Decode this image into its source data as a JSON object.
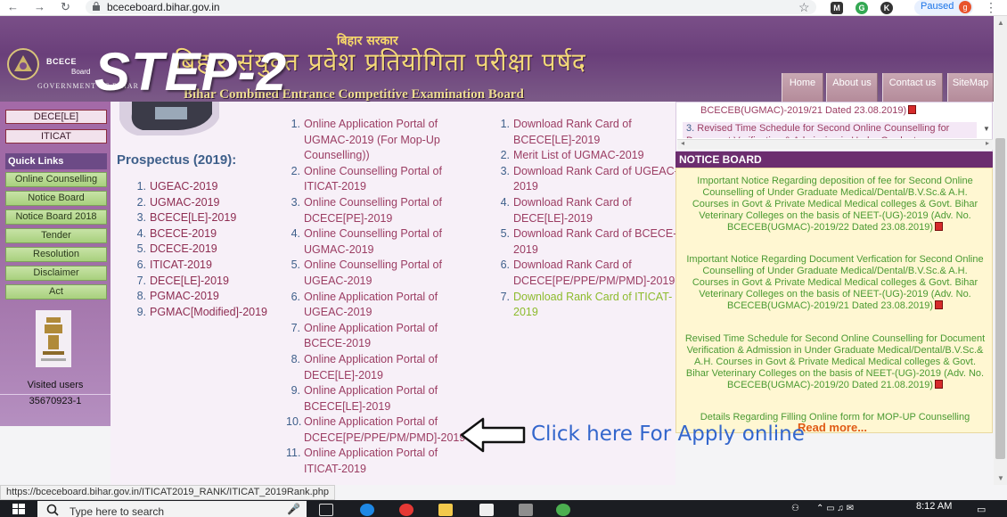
{
  "browser": {
    "url": "bceceboard.bihar.gov.in",
    "profile_status": "Paused",
    "profile_initial": "g",
    "extension_k": "K"
  },
  "header": {
    "logo_text": "BCECE",
    "logo_sub": "Board",
    "gov_text": "GOVERNMENT OF BIHAR",
    "hindi_state": "बिहार सरकार",
    "hindi_title": "बिहार संयुक्त प्रवेश प्रतियोगिता परीक्षा पर्षद",
    "english_title": "Bihar Combined Entrance Competitive Examination Board",
    "step_overlay": "STEP-2",
    "nav": [
      "Home",
      "About us",
      "Contact us",
      "SiteMap"
    ]
  },
  "sidebar": {
    "top_items": [
      "DECE[LE]",
      "ITICAT"
    ],
    "quick_links_title": "Quick Links",
    "quick_links": [
      "Online Counselling",
      "Notice Board",
      "Notice Board 2018",
      "Tender",
      "Resolution",
      "Disclaimer",
      "Act"
    ],
    "visited_label": "Visited users",
    "visited_count": "35670923-1"
  },
  "prospectus": {
    "title": "Prospectus (2019):",
    "items": [
      "UGEAC-2019",
      "UGMAC-2019",
      "BCECE[LE]-2019",
      "BCECE-2019",
      "DCECE-2019",
      "ITICAT-2019",
      "DECE[LE]-2019",
      "PGMAC-2019",
      "PGMAC[Modified]-2019"
    ]
  },
  "portals": {
    "items": [
      "Online Application Portal of UGMAC-2019 (For Mop-Up Counselling))",
      "Online Counselling Portal of ITICAT-2019",
      "Online Counselling Portal of DCECE[PE]-2019",
      "Online Counselling Portal of UGMAC-2019",
      "Online Counselling Portal of UGEAC-2019",
      "Online Application Portal of UGEAC-2019",
      "Online Application Portal of BCECE-2019",
      "Online Application Portal of DECE[LE]-2019",
      "Online Application Portal of BCECE[LE]-2019",
      "Online Application Portal of DCECE[PE/PPE/PM/PMD]-2019",
      "Online Application Portal of ITICAT-2019"
    ]
  },
  "results": {
    "items": [
      "Download Rank Card of BCECE[LE]-2019",
      "Merit List of UGMAC-2019",
      "Download Rank Card of UGEAC-2019",
      "Download Rank Card of DECE[LE]-2019",
      "Download Rank Card of BCECE-2019",
      "Download Rank Card of DCECE[PE/PPE/PM/PMD]-2019",
      "Download Rank Card of ITICAT-2019"
    ]
  },
  "scroll_box": {
    "top_text": "BCECEB(UGMAC)-2019/21 Dated 23.08.2019)",
    "item3_num": "3.",
    "item3_text": "Revised Time Schedule for Second Online Counselling for Document Verification & Admission in Under Graduate"
  },
  "notice_board": {
    "title": "NOTICE BOARD",
    "notices": [
      "Important Notice Regarding deposition of fee for Second Online Counselling of Under Graduate Medical/Dental/B.V.Sc.& A.H. Courses in Govt & Private Medical Medical colleges & Govt. Bihar Veterinary Colleges on the basis of NEET-(UG)-2019 (Adv. No. BCECEB(UGMAC)-2019/22 Dated 23.08.2019)",
      "Important Notice Regarding Document Verfication for Second Online Counselling of Under Graduate Medical/Dental/B.V.Sc.& A.H. Courses in Govt & Private Medical Medical colleges & Govt. Bihar Veterinary Colleges on the basis of NEET-(UG)-2019 (Adv. No. BCECEB(UGMAC)-2019/21 Dated 23.08.2019)",
      "Revised Time Schedule for Second Online Counselling for Document Verification & Admission in Under Graduate Medical/Dental/B.V.Sc.& A.H. Courses in Govt & Private Medical Medical colleges & Govt. Bihar Veterinary Colleges on the basis of NEET-(UG)-2019 (Adv. No. BCECEB(UGMAC)-2019/20 Dated 21.08.2019)",
      "Details Regarding Filling Online form for MOP-UP Counselling"
    ],
    "read_more": "Read more..."
  },
  "annotation": {
    "text": "Click here For Apply online"
  },
  "status_bar": {
    "url": "https://bceceboard.bihar.gov.in/ITICAT2019_RANK/ITICAT_2019Rank.php"
  },
  "taskbar": {
    "search_placeholder": "Type here to search",
    "time": "8:12 AM"
  },
  "colors": {
    "banner": "#6a3f7a",
    "link_blue": "#3e5f8a",
    "link_maroon": "#9b3d63",
    "highlight_green": "#8dbb2d",
    "notice_green": "#4a9a32",
    "notice_bg": "#fff7d2",
    "annotation_blue": "#3366cc"
  }
}
